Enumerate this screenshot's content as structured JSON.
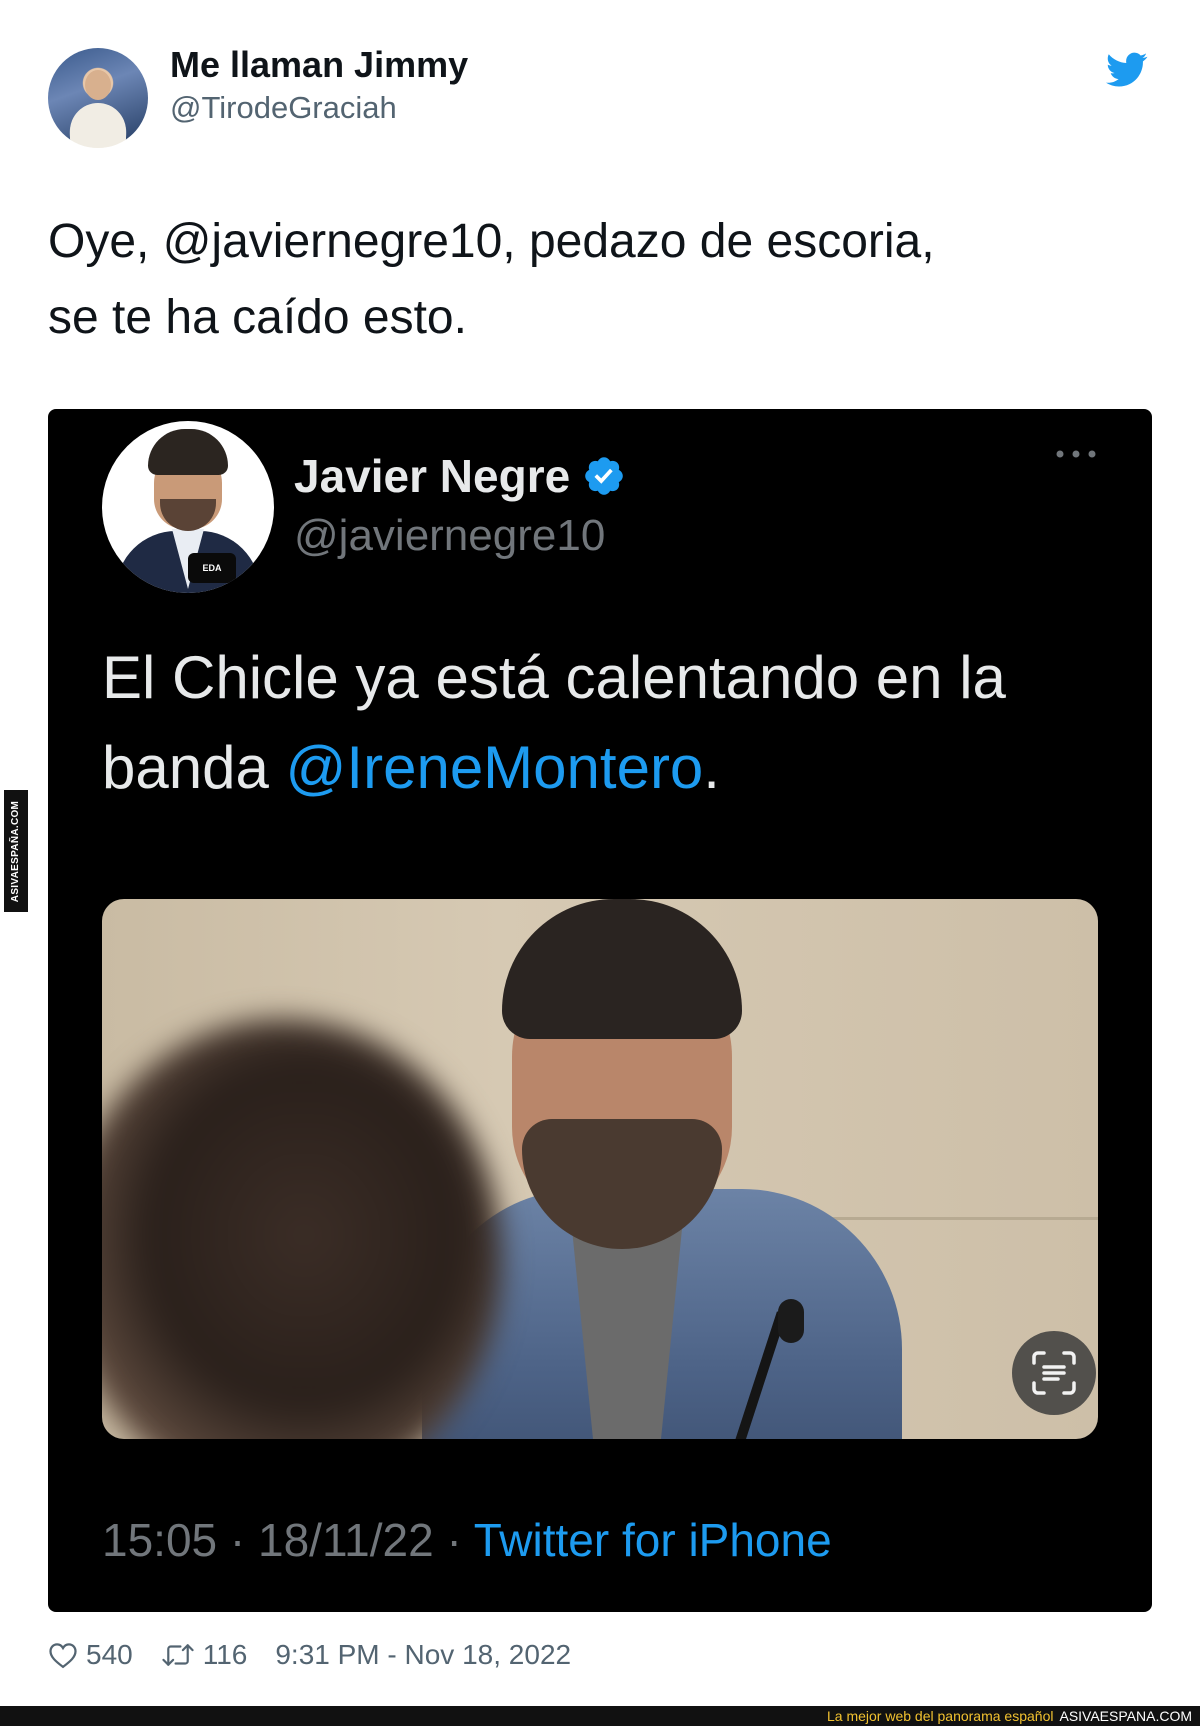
{
  "author": {
    "display_name": "Me llaman Jimmy",
    "handle": "@TirodeGraciah"
  },
  "tweet": {
    "text_part1": "Oye, ",
    "mention": "@javiernegre10",
    "text_part2": ", pedazo de escoria,",
    "text_line2": "se te ha caído esto."
  },
  "embedded_tweet": {
    "display_name": "Javier Negre",
    "handle": "@javiernegre10",
    "avatar_mic_text": "EDA",
    "text_part1": "El Chicle ya está calentando en la banda ",
    "mention": "@IreneMontero",
    "text_part2": ".",
    "time": "15:05",
    "date": "18/11/22",
    "separator": " · ",
    "source": "Twitter for iPhone"
  },
  "metrics": {
    "likes": "540",
    "retweets": "116",
    "timestamp": "9:31 PM - Nov 18, 2022"
  },
  "watermark": {
    "side": "ASIVAESPAÑA.COM",
    "tagline": "La mejor web del panorama español",
    "site": "ASIVAESPANA.COM"
  },
  "colors": {
    "twitter_blue": "#1d9bf0",
    "embed_background": "#000000",
    "tagline_yellow": "#f2c230"
  },
  "icons": {
    "bird": "twitter-bird-icon",
    "verified": "verified-badge-icon",
    "more": "more-options-icon",
    "scan": "scan-text-icon",
    "like": "heart-icon",
    "retweet": "retweet-icon"
  }
}
